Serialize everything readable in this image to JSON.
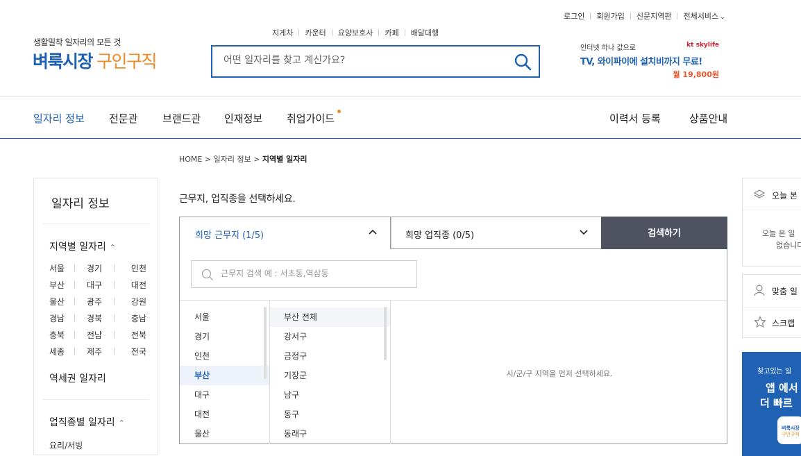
{
  "utility_links": [
    "로그인",
    "회원가입",
    "신문지역판",
    "전체서비스"
  ],
  "logo": {
    "subtitle": "생활밀착 일자리의 모든 것",
    "main_blue": "벼룩시장",
    "main_orange": "구인구직"
  },
  "hot_keywords": [
    "지게차",
    "카운터",
    "요양보호사",
    "카페",
    "배달대행"
  ],
  "search": {
    "placeholder": "어떤 일자리를 찾고 계신가요?"
  },
  "ad": {
    "brand": "kt skylife",
    "line1": "인터넷 하나 값으로",
    "line2": "TV, 와이파이에 설치비까지 무료!",
    "line3": "월 19,800원"
  },
  "nav": {
    "left": [
      "일자리 정보",
      "전문관",
      "브랜드관",
      "인재정보",
      "취업가이드"
    ],
    "right": [
      "이력서 등록",
      "상품안내"
    ]
  },
  "breadcrumb": {
    "home": "HOME",
    "sep": ">",
    "level1": "일자리 정보",
    "current": "지역별 일자리"
  },
  "sidebar": {
    "title": "일자리 정보",
    "region_heading": "지역별 일자리",
    "regions": [
      [
        "서울",
        "경기",
        "인천"
      ],
      [
        "부산",
        "대구",
        "대전"
      ],
      [
        "울산",
        "광주",
        "강원"
      ],
      [
        "경남",
        "경북",
        "충남"
      ],
      [
        "충북",
        "전남",
        "전북"
      ],
      [
        "세종",
        "제주",
        "전국"
      ]
    ],
    "station_heading": "역세권 일자리",
    "job_heading": "업직종별 일자리",
    "job_first": "요리/서빙"
  },
  "main": {
    "question": "근무지, 업직종을 선택하세요.",
    "location_select": "희망 근무지 (1/5)",
    "job_select": "희망 업직종 (0/5)",
    "search_button": "검색하기",
    "location_search_placeholder": "근무지 검색 예 : 서초동,역삼동",
    "cities": [
      "서울",
      "경기",
      "인천",
      "부산",
      "대구",
      "대전",
      "울산"
    ],
    "active_city": "부산",
    "districts": [
      "부산 전체",
      "강서구",
      "금정구",
      "기장군",
      "남구",
      "동구",
      "동래구"
    ],
    "empty_message": "시/군/구 지역을 먼저 선택하세요."
  },
  "right_sidebar": {
    "recent_label": "오늘 본",
    "recent_empty_line1": "오늘 본 일",
    "recent_empty_line2": "없습니다",
    "custom_label": "맞춤 일",
    "scrap_label": "스크랩",
    "banner_line1": "찾고있는 일",
    "banner_line2": "앱 에서",
    "banner_line3": "더 빠르",
    "banner_app_line1": "벼룩시장",
    "banner_app_line2": "구인구직"
  }
}
